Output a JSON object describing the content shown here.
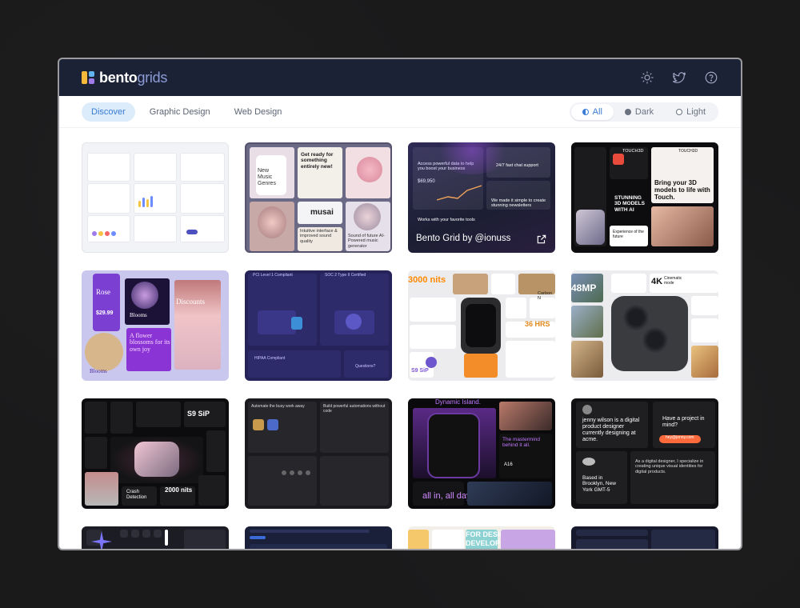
{
  "header": {
    "logo_bold": "bento",
    "logo_light": "grids",
    "icons": [
      "sun-icon",
      "twitter-icon",
      "help-icon"
    ]
  },
  "nav": {
    "tabs": [
      {
        "label": "Discover",
        "active": true
      },
      {
        "label": "Graphic Design",
        "active": false
      },
      {
        "label": "Web Design",
        "active": false
      }
    ],
    "themes": [
      {
        "label": "All",
        "active": true
      },
      {
        "label": "Dark",
        "active": false
      },
      {
        "label": "Light",
        "active": false
      }
    ]
  },
  "cards": {
    "c2": {
      "t1": "New Music Genres",
      "t2": "Get ready for something entirely new!",
      "t3": "musai",
      "t4": "Sound of future AI-Powered music generator",
      "t5": "Intuitive interface & improved sound quality"
    },
    "c3": {
      "caption": "Bento Grid by @ionuss",
      "t1": "Access powerful data to help you boost your business",
      "t2": "24/7 fast chat support",
      "t3": "$69,950",
      "t4": "We made it simple to create stunning newsletters",
      "t5": "Works with your favorite tools"
    },
    "c4": {
      "t1": "TOUCH3D",
      "t2": "Bring your 3D models to life with Touch.",
      "t3": "STUNNING 3D MODELS WITH AI",
      "t4": "Experience of the future"
    },
    "c5": {
      "t1": "Rose",
      "t2": "$29.99",
      "t3": "Blooms",
      "t4": "Discounts",
      "t5": "A flower blossoms for its own joy",
      "t6": "Blooms"
    },
    "c6": {
      "t1": "PCI Level 1 Compliant",
      "t2": "SOC 2 Type II Certified",
      "t3": "HIPAA Compliant",
      "t4": "Questions?"
    },
    "c7": {
      "t1": "3000 nits",
      "t2": "36 HRS",
      "t3": "Carbon N",
      "t4": "S9 SiP"
    },
    "c8": {
      "t1": "48MP",
      "t2": "4K",
      "t3": "Cinematic mode"
    },
    "c9": {
      "t1": "S9 SiP",
      "t2": "Crash Detection",
      "t3": "2000 nits"
    },
    "c10": {
      "t1": "Automate the busy work away",
      "t2": "Build powerful automations without code"
    },
    "c11": {
      "t1": "Dynamic Island.",
      "t2": "The mastermind behind it all.",
      "t3": "A16",
      "t4": "all in, all day."
    },
    "c12": {
      "t1": "jenny wilson is a digital product designer currently designing at acme.",
      "t2": "Have a project in mind?",
      "t3": "hey@jenny.com",
      "t4": "Based in Brooklyn, New York GMT-5",
      "t5": "As a digital designer, I specialize in creating unique visual identities for digital products."
    },
    "c15": {
      "t1": "FOR DESIGN",
      "t2": "DEVELOP",
      "t3": "FOR DES"
    }
  },
  "colors": {
    "topbar": "#1c2236",
    "accent": "#3a7bd5",
    "tab_active_bg": "#dcecfa"
  }
}
